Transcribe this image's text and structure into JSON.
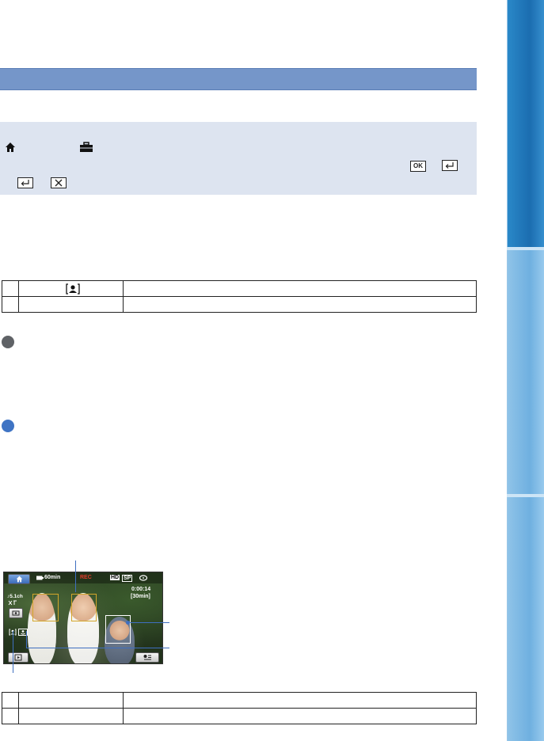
{
  "menu_box": {
    "ok_label": "OK"
  },
  "table1": {
    "rows": [
      {
        "num": "",
        "col2": "",
        "col3": ""
      },
      {
        "num": "",
        "col2": "",
        "col3": ""
      }
    ]
  },
  "table2": {
    "rows": [
      {
        "num": "",
        "col2": "",
        "col3": ""
      },
      {
        "num": "",
        "col2": "",
        "col3": ""
      }
    ]
  },
  "screenshot": {
    "battery_time": "60min",
    "quality_left": "HD",
    "quality_right": "SP",
    "timecode": "0:00:14",
    "remaining": "[30min]",
    "audio_label": "♪5.1ch",
    "rec_label": "REC"
  },
  "colors": {
    "section_header": "#7596c9",
    "menu_box_bg": "#dde4f0",
    "tab_active": "#1b6db0",
    "tab_inactive": "#6fb0e0",
    "circle_gray": "#5f6266",
    "circle_blue": "#3f74c4",
    "face_frame": "#d4a62a",
    "callout": "#3f6fc0"
  }
}
